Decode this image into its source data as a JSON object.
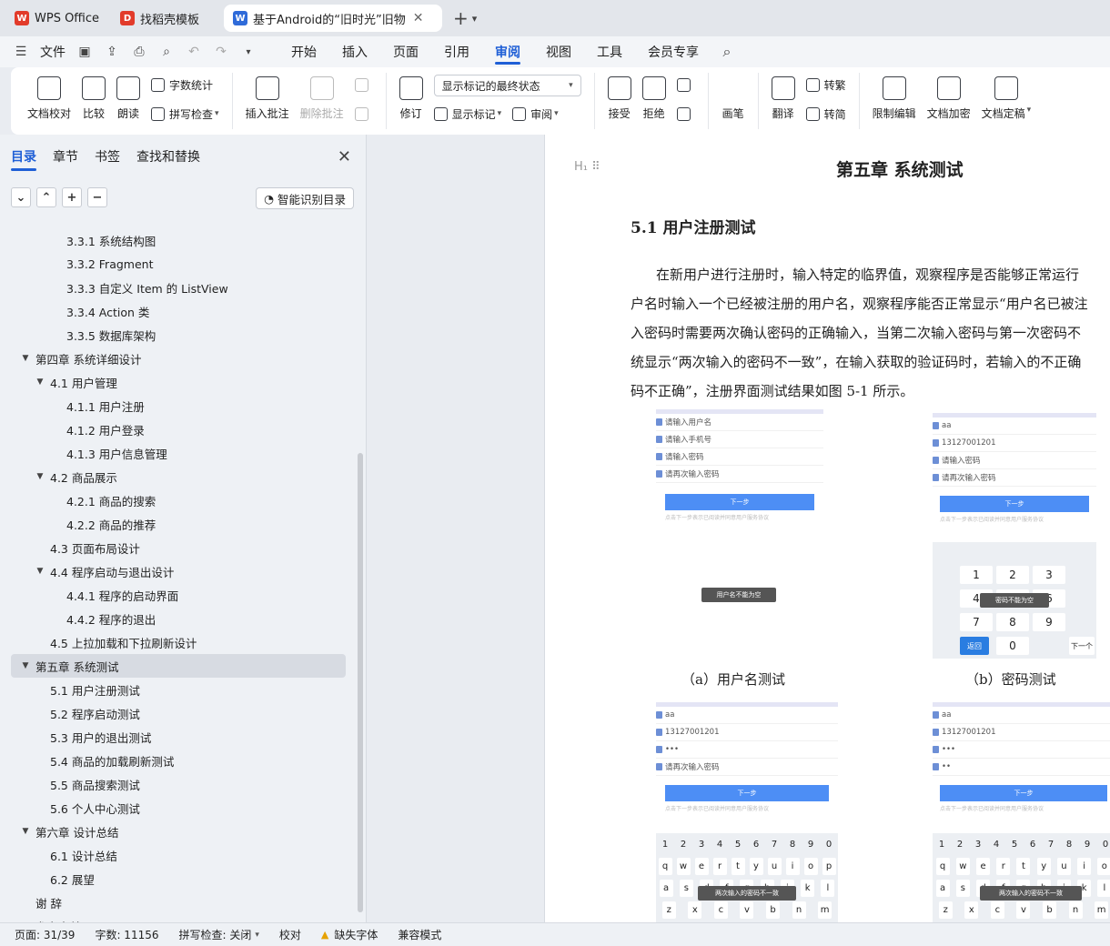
{
  "tabs": [
    {
      "label": "WPS Office",
      "logo": "W",
      "logo_color": "#e23b2a"
    },
    {
      "label": "找稻壳模板",
      "logo": "D",
      "logo_color": "#e23b2a"
    },
    {
      "label": "基于Android的“旧时光”旧物",
      "logo": "W",
      "logo_color": "#2f6bd9"
    }
  ],
  "menu": {
    "file": "文件",
    "items": [
      "开始",
      "插入",
      "页面",
      "引用",
      "审阅",
      "视图",
      "工具",
      "会员专享"
    ],
    "active_index": 4
  },
  "ribbon": {
    "doc_check": "文档校对",
    "compare": "比较",
    "read_aloud": "朗读",
    "word_count": "字数统计",
    "spell_check": "拼写检查",
    "insert_comment": "插入批注",
    "delete_comment": "删除批注",
    "revise": "修订",
    "markup_dropdown": "显示标记的最终状态",
    "show_markup": "显示标记",
    "review": "审阅",
    "accept": "接受",
    "reject": "拒绝",
    "ink": "画笔",
    "translate": "翻译",
    "to_traditional": "转繁",
    "to_simplified": "转简",
    "restrict_edit": "限制编辑",
    "encrypt_doc": "文档加密",
    "finalize": "文档定稿"
  },
  "panel": {
    "tabs": [
      "目录",
      "章节",
      "书签",
      "查找和替换"
    ],
    "active_tab": 0,
    "smart_toc": "智能识别目录"
  },
  "toc": [
    {
      "label": "3.3.1 系统结构图",
      "level": 3,
      "toggle": ""
    },
    {
      "label": "3.3.2 Fragment",
      "level": 3,
      "toggle": ""
    },
    {
      "label": "3.3.3 自定义 Item 的 ListView",
      "level": 3,
      "toggle": ""
    },
    {
      "label": "3.3.4 Action 类",
      "level": 3,
      "toggle": ""
    },
    {
      "label": "3.3.5  数据库架构",
      "level": 3,
      "toggle": ""
    },
    {
      "label": "第四章  系统详细设计",
      "level": 1,
      "toggle": "▼"
    },
    {
      "label": "4.1  用户管理",
      "level": 2,
      "toggle": "▼"
    },
    {
      "label": "4.1.1 用户注册",
      "level": 3,
      "toggle": ""
    },
    {
      "label": "4.1.2 用户登录",
      "level": 3,
      "toggle": ""
    },
    {
      "label": "4.1.3  用户信息管理",
      "level": 3,
      "toggle": ""
    },
    {
      "label": "4.2  商品展示",
      "level": 2,
      "toggle": "▼"
    },
    {
      "label": "4.2.1 商品的搜索",
      "level": 3,
      "toggle": ""
    },
    {
      "label": "4.2.2 商品的推荐",
      "level": 3,
      "toggle": ""
    },
    {
      "label": "4.3  页面布局设计",
      "level": 2,
      "toggle": ""
    },
    {
      "label": "4.4  程序启动与退出设计",
      "level": 2,
      "toggle": "▼"
    },
    {
      "label": "4.4.1 程序的启动界面",
      "level": 3,
      "toggle": ""
    },
    {
      "label": "4.4.2 程序的退出",
      "level": 3,
      "toggle": ""
    },
    {
      "label": "4.5  上拉加载和下拉刷新设计",
      "level": 2,
      "toggle": ""
    },
    {
      "label": "第五章  系统测试",
      "level": 1,
      "toggle": "▼",
      "selected": true
    },
    {
      "label": "5.1  用户注册测试",
      "level": 2,
      "toggle": ""
    },
    {
      "label": "5.2 程序启动测试",
      "level": 2,
      "toggle": ""
    },
    {
      "label": "5.3 用户的退出测试",
      "level": 2,
      "toggle": ""
    },
    {
      "label": "5.4 商品的加载刷新测试",
      "level": 2,
      "toggle": ""
    },
    {
      "label": "5.5 商品搜索测试",
      "level": 2,
      "toggle": ""
    },
    {
      "label": "5.6 个人中心测试",
      "level": 2,
      "toggle": ""
    },
    {
      "label": "第六章  设计总结",
      "level": 1,
      "toggle": "▼"
    },
    {
      "label": "6.1  设计总结",
      "level": 2,
      "toggle": ""
    },
    {
      "label": "6.2  展望",
      "level": 2,
      "toggle": ""
    },
    {
      "label": "谢    辞",
      "level": 1,
      "toggle": ""
    },
    {
      "label": "参考文献",
      "level": 1,
      "toggle": ""
    }
  ],
  "doc": {
    "chapter_title": "第五章  系统测试",
    "section_title": "5.1  用户注册测试",
    "para_lines": [
      "在新用户进行注册时，输入特定的临界值，观察程序是否能够正常运行",
      "户名时输入一个已经被注册的用户名，观察程序能否正常显示“用户名已被注",
      "入密码时需要两次确认密码的正确输入，当第二次输入密码与第一次密码不",
      "统显示“两次输入的密码不一致”，在输入获取的验证码时，若输入的不正确",
      "码不正确”，注册界面测试结果如图 5-1 所示。"
    ],
    "caption_a": "（a）用户名测试",
    "caption_b": "（b）密码测试"
  },
  "figures": {
    "a": {
      "fields": [
        "请输入用户名",
        "请输入手机号",
        "请输入密码",
        "请再次输入密码"
      ],
      "button": "下一步",
      "agree": "点击下一步表示已阅读并同意用户服务协议",
      "toast": "用户名不能为空"
    },
    "b": {
      "fields": [
        "aa",
        "13127001201",
        "请输入密码",
        "请再次输入密码"
      ],
      "button": "下一步",
      "agree": "点击下一步表示已阅读并同意用户服务协议",
      "toast": "密码不能为空",
      "keys": [
        "1",
        "2",
        "3",
        "4",
        "5",
        "6",
        "7",
        "8",
        "9",
        "0"
      ],
      "return_key": "返回",
      "next_key": "下一个"
    },
    "c": {
      "fields": [
        "aa",
        "13127001201",
        "•••",
        "请再次输入密码"
      ],
      "button": "下一步",
      "agree": "点击下一步表示已阅读并同意用户服务协议",
      "toast": "两次输入的密码不一致",
      "kb_row1": [
        "1",
        "2",
        "3",
        "4",
        "5",
        "6",
        "7",
        "8",
        "9",
        "0"
      ],
      "kb_row2": [
        "q",
        "w",
        "e",
        "r",
        "t",
        "y",
        "u",
        "i",
        "o",
        "p"
      ],
      "kb_row3": [
        "a",
        "s",
        "d",
        "f",
        "g",
        "h",
        "j",
        "k",
        "l"
      ],
      "kb_row4": [
        "z",
        "x",
        "c",
        "v",
        "b",
        "n",
        "m"
      ]
    },
    "d": {
      "fields": [
        "aa",
        "13127001201",
        "•••",
        "••"
      ],
      "button": "下一步",
      "agree": "点击下一步表示已阅读并同意用户服务协议",
      "toast": "两次输入的密码不一致",
      "kb_row1": [
        "1",
        "2",
        "3",
        "4",
        "5",
        "6",
        "7",
        "8",
        "9",
        "0"
      ],
      "kb_row2": [
        "q",
        "w",
        "e",
        "r",
        "t",
        "y",
        "u",
        "i",
        "o"
      ],
      "kb_row3": [
        "a",
        "s",
        "d",
        "f",
        "g",
        "h",
        "j",
        "k",
        "l"
      ],
      "kb_row4": [
        "z",
        "x",
        "c",
        "v",
        "b",
        "n",
        "m"
      ]
    }
  },
  "status": {
    "page": "页面: 31/39",
    "words": "字数: 11156",
    "spell": "拼写检查: 关闭",
    "proof": "校对",
    "missing_font": "缺失字体",
    "compat": "兼容模式"
  }
}
